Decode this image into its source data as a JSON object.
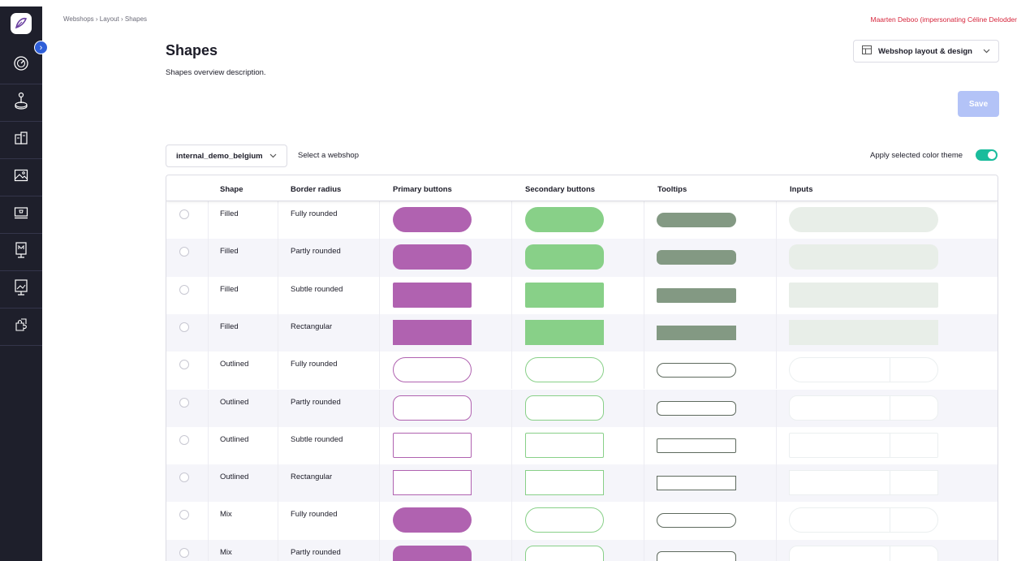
{
  "breadcrumb": "Webshops  ›  Layout  ›  Shapes",
  "user_notice": "Maarten Deboo (impersonating Céline Delodder",
  "page": {
    "title": "Shapes",
    "description": "Shapes overview description."
  },
  "layout_select": {
    "label": "Webshop layout & design"
  },
  "save_label": "Save",
  "webshop_select": {
    "value": "internal_demo_belgium",
    "hint": "Select a webshop"
  },
  "theme": {
    "label": "Apply selected color theme",
    "enabled": true
  },
  "colors": {
    "primary": "#b062b0",
    "secondary": "#88d088",
    "tooltip": "#839983",
    "input": "#e8eee8",
    "toggle": "#1abc9c",
    "save": "#b3c3f7",
    "sidebar": "#1e1f2b"
  },
  "table": {
    "headers": [
      "Shape",
      "Border radius",
      "Primary buttons",
      "Secondary buttons",
      "Tooltips",
      "Inputs"
    ],
    "rows": [
      {
        "shape": "Filled",
        "radius": "Fully rounded"
      },
      {
        "shape": "Filled",
        "radius": "Partly rounded"
      },
      {
        "shape": "Filled",
        "radius": "Subtle rounded"
      },
      {
        "shape": "Filled",
        "radius": "Rectangular"
      },
      {
        "shape": "Outlined",
        "radius": "Fully rounded"
      },
      {
        "shape": "Outlined",
        "radius": "Partly rounded"
      },
      {
        "shape": "Outlined",
        "radius": "Subtle rounded"
      },
      {
        "shape": "Outlined",
        "radius": "Rectangular"
      },
      {
        "shape": "Mix",
        "radius": "Fully rounded"
      },
      {
        "shape": "Mix",
        "radius": "Partly rounded"
      }
    ]
  },
  "sidebar_icons": [
    "dashboard-icon",
    "joystick-icon",
    "products-icon",
    "media-icon",
    "webshop-icon",
    "marketing-icon",
    "presentation-icon",
    "integrations-icon"
  ]
}
